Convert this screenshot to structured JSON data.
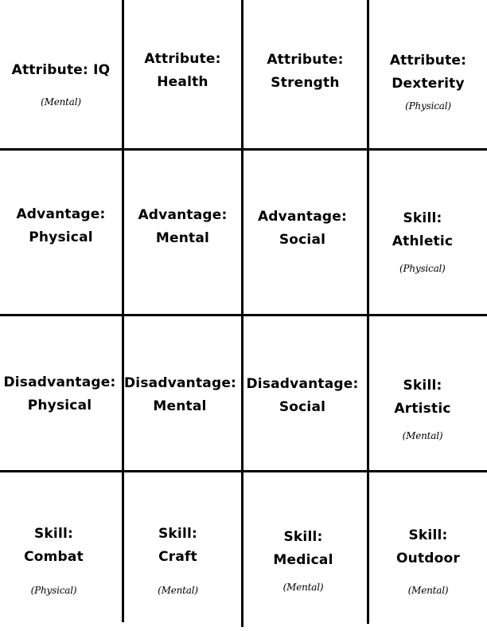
{
  "cards": [
    {
      "line1": "Attribute: IQ",
      "line2": "",
      "sub": "(Mental)"
    },
    {
      "line1": "Attribute:",
      "line2": "Health",
      "sub": ""
    },
    {
      "line1": "Attribute:",
      "line2": "Strength",
      "sub": ""
    },
    {
      "line1": "Attribute:",
      "line2": "Dexterity",
      "sub": "(Physical)"
    },
    {
      "line1": "Advantage:",
      "line2": "Physical",
      "sub": ""
    },
    {
      "line1": "Advantage:",
      "line2": "Mental",
      "sub": ""
    },
    {
      "line1": "Advantage:",
      "line2": "Social",
      "sub": ""
    },
    {
      "line1": "Skill:",
      "line2": "Athletic",
      "sub": "(Physical)"
    },
    {
      "line1": "Disadvantage:",
      "line2": "Physical",
      "sub": ""
    },
    {
      "line1": "Disadvantage:",
      "line2": "Mental",
      "sub": ""
    },
    {
      "line1": "Disadvantage:",
      "line2": "Social",
      "sub": ""
    },
    {
      "line1": "Skill:",
      "line2": "Artistic",
      "sub": "(Mental)"
    },
    {
      "line1": "Skill:",
      "line2": "Combat",
      "sub": "(Physical)"
    },
    {
      "line1": "Skill:",
      "line2": "Craft",
      "sub": "(Mental)"
    },
    {
      "line1": "Skill:",
      "line2": "Medical",
      "sub": "(Mental)"
    },
    {
      "line1": "Skill:",
      "line2": "Outdoor",
      "sub": "(Mental)"
    }
  ]
}
